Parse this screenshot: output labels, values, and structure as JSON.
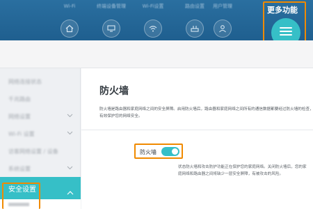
{
  "header": {
    "nav": [
      {
        "label": "Wi-Fi",
        "icon": "home-icon"
      },
      {
        "label": "终端设备管理",
        "icon": "devices-icon"
      },
      {
        "label": "Wi-Fi设置",
        "icon": "wifi-icon"
      },
      {
        "label": "路由设置",
        "icon": "router-icon"
      },
      {
        "label": "用户管理",
        "icon": "user-icon"
      }
    ],
    "more_label": "更多功能",
    "more_icon": "hamburger-menu-icon"
  },
  "sidebar": {
    "items": [
      {
        "label": "网络连接状态"
      },
      {
        "label": "千兆路由"
      },
      {
        "label": "网络设置",
        "chevron": true
      },
      {
        "label": "Wi-Fi 设置",
        "chevron": true
      },
      {
        "label": "访客网络设置 / 设备"
      },
      {
        "label": "系统设置",
        "chevron": true
      }
    ],
    "active": {
      "label": "安全设置"
    }
  },
  "main": {
    "title": "防火墙",
    "description": "防火墙是路由器和家庭网络之间的安全屏障。启用防火墙后，路由器和家庭网络之间所有的通信数据都要经过防火墙的检查，有效保护您的网络安全。",
    "toggle_label": "防火墙",
    "toggle_on": true,
    "status": "状态防火墙和攻击防护功能正在保护您的家庭网络。关闭防火墙后，您的家庭网络和路由器之间将缺少一层安全屏障，有被攻击的风险。"
  },
  "colors": {
    "header": "#1f5f8f",
    "accent": "#36bfc7",
    "highlight": "#f08a00"
  }
}
